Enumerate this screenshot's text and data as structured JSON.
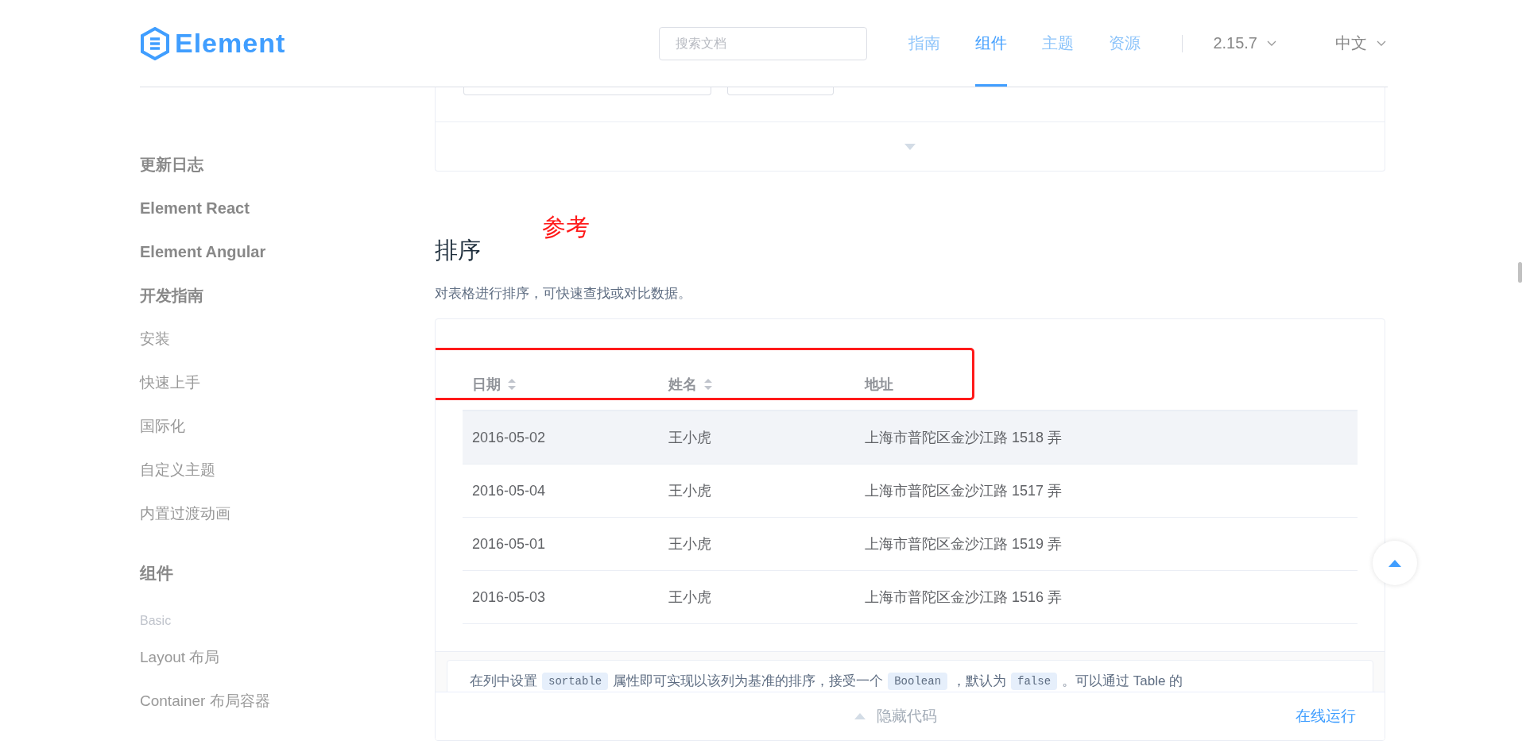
{
  "header": {
    "logo": "Element",
    "search": {
      "placeholder": "搜索文档"
    },
    "nav": [
      {
        "label": "指南",
        "selected": false
      },
      {
        "label": "组件",
        "selected": true
      },
      {
        "label": "主题",
        "selected": false
      },
      {
        "label": "资源",
        "selected": false
      }
    ],
    "version": "2.15.7",
    "language": "中文"
  },
  "sidebar": {
    "items": [
      {
        "label": "更新日志",
        "kind": "heading"
      },
      {
        "label": "Element React",
        "kind": "heading"
      },
      {
        "label": "Element Angular",
        "kind": "heading"
      },
      {
        "label": "开发指南",
        "kind": "heading"
      },
      {
        "label": "安装",
        "kind": "link"
      },
      {
        "label": "快速上手",
        "kind": "link"
      },
      {
        "label": "国际化",
        "kind": "link"
      },
      {
        "label": "自定义主题",
        "kind": "link"
      },
      {
        "label": "内置过渡动画",
        "kind": "link"
      },
      {
        "label": "组件",
        "kind": "section"
      },
      {
        "label": "Basic",
        "kind": "group"
      },
      {
        "label": "Layout 布局",
        "kind": "link"
      },
      {
        "label": "Container 布局容器",
        "kind": "link"
      }
    ]
  },
  "section": {
    "title": "排序",
    "annotation": "参考",
    "description": "对表格进行排序，可快速查找或对比数据。",
    "table": {
      "columns": [
        {
          "label": "日期",
          "sortable": true
        },
        {
          "label": "姓名",
          "sortable": true
        },
        {
          "label": "地址",
          "sortable": false
        }
      ],
      "rows": [
        {
          "hovered": true,
          "cells": [
            "2016-05-02",
            "王小虎",
            "上海市普陀区金沙江路 1518 弄"
          ]
        },
        {
          "hovered": false,
          "cells": [
            "2016-05-04",
            "王小虎",
            "上海市普陀区金沙江路 1517 弄"
          ]
        },
        {
          "hovered": false,
          "cells": [
            "2016-05-01",
            "王小虎",
            "上海市普陀区金沙江路 1519 弄"
          ]
        },
        {
          "hovered": false,
          "cells": [
            "2016-05-03",
            "王小虎",
            "上海市普陀区金沙江路 1516 弄"
          ]
        }
      ]
    },
    "code_description": [
      {
        "kind": "text",
        "text": "在列中设置"
      },
      {
        "kind": "code",
        "text": "sortable"
      },
      {
        "kind": "text",
        "text": "属性即可实现以该列为基准的排序，接受一个"
      },
      {
        "kind": "code",
        "text": "Boolean"
      },
      {
        "kind": "text",
        "text": "，默认为"
      },
      {
        "kind": "code",
        "text": "false"
      },
      {
        "kind": "text",
        "text": "。可以通过 Table 的"
      }
    ],
    "footer": {
      "toggle": "隐藏代码",
      "run": "在线运行"
    }
  }
}
